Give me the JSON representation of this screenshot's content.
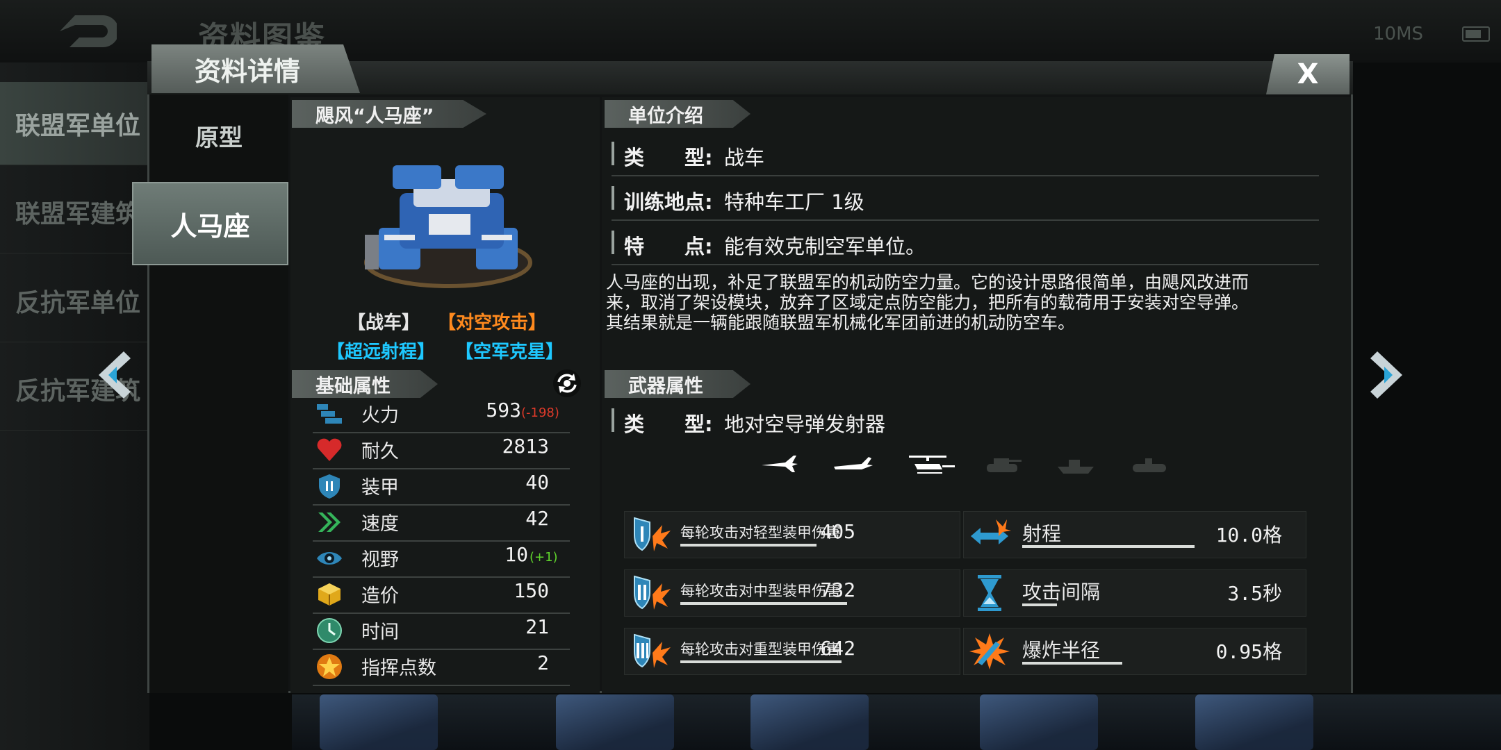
{
  "background": {
    "title": "资料图鉴",
    "network_status": "10MS",
    "nav_items": [
      "联盟军单位",
      "联盟军建筑",
      "反抗军单位",
      "反抗军建筑"
    ]
  },
  "panel": {
    "header_title": "资料详情",
    "close_label": "X",
    "tabs": [
      {
        "label": "原型"
      },
      {
        "label": "人马座",
        "active": true
      }
    ]
  },
  "unit": {
    "name": "飓风“人马座”",
    "tags": [
      {
        "label": "【战车】",
        "color": "#ffffff"
      },
      {
        "label": "【对空攻击】",
        "color": "#ff8a1e"
      },
      {
        "label": "【超远射程】",
        "color": "#1ec8ff"
      },
      {
        "label": "【空军克星】",
        "color": "#1ec8ff"
      }
    ]
  },
  "base_stats": {
    "title": "基础属性",
    "rows": [
      {
        "icon": "firepower-icon",
        "name": "火力",
        "value": "593",
        "mod": "(-198)",
        "mod_color": "#e03a2a"
      },
      {
        "icon": "heart-icon",
        "name": "耐久",
        "value": "2813",
        "mod": "",
        "mod_color": ""
      },
      {
        "icon": "armor-shield-icon",
        "name": "装甲",
        "value": "40",
        "mod": "",
        "mod_color": ""
      },
      {
        "icon": "speed-chevrons-icon",
        "name": "速度",
        "value": "42",
        "mod": "",
        "mod_color": ""
      },
      {
        "icon": "eye-icon",
        "name": "视野",
        "value": "10",
        "mod": "(+1)",
        "mod_color": "#5fd42c"
      },
      {
        "icon": "cost-cube-icon",
        "name": "造价",
        "value": "150",
        "mod": "",
        "mod_color": ""
      },
      {
        "icon": "clock-icon",
        "name": "时间",
        "value": "21",
        "mod": "",
        "mod_color": ""
      },
      {
        "icon": "command-star-icon",
        "name": "指挥点数",
        "value": "2",
        "mod": "",
        "mod_color": ""
      }
    ]
  },
  "intro": {
    "title": "单位介绍",
    "rows": [
      {
        "label": "类　　型:",
        "value": "战车"
      },
      {
        "label": "训练地点:",
        "value": "特种车工厂 1级"
      },
      {
        "label": "特　　点:",
        "value": "能有效克制空军单位。"
      }
    ],
    "description_lines": [
      "人马座的出现，补足了联盟军的机动防空力量。它的设计思路很简单，由飓风改进而",
      "来，取消了架设模块，放弃了区域定点防空能力，把所有的载荷用于安装对空导弹。",
      "其结果就是一辆能跟随联盟军机械化军团前进的机动防空车。"
    ]
  },
  "weapon": {
    "title": "武器属性",
    "type_label": "类　　型:",
    "type_value": "地对空导弹发射器",
    "targets": [
      {
        "icon": "fighter-jet-icon",
        "active": true
      },
      {
        "icon": "bomber-plane-icon",
        "active": true
      },
      {
        "icon": "helicopter-icon",
        "active": true
      },
      {
        "icon": "tank-icon",
        "active": false
      },
      {
        "icon": "ship-icon",
        "active": false
      },
      {
        "icon": "submarine-icon",
        "active": false
      }
    ],
    "stats": [
      {
        "icon": "light-armor-icon",
        "label": "每轮攻击对轻型装甲伤害",
        "value": "405"
      },
      {
        "icon": "range-arrows-icon",
        "label": "射程",
        "value": "10.0格"
      },
      {
        "icon": "medium-armor-icon",
        "label": "每轮攻击对中型装甲伤害",
        "value": "732"
      },
      {
        "icon": "hourglass-icon",
        "label": "攻击间隔",
        "value": "3.5秒"
      },
      {
        "icon": "heavy-armor-icon",
        "label": "每轮攻击对重型装甲伤害",
        "value": "642"
      },
      {
        "icon": "explosion-icon",
        "label": "爆炸半径",
        "value": "0.95格"
      }
    ]
  }
}
